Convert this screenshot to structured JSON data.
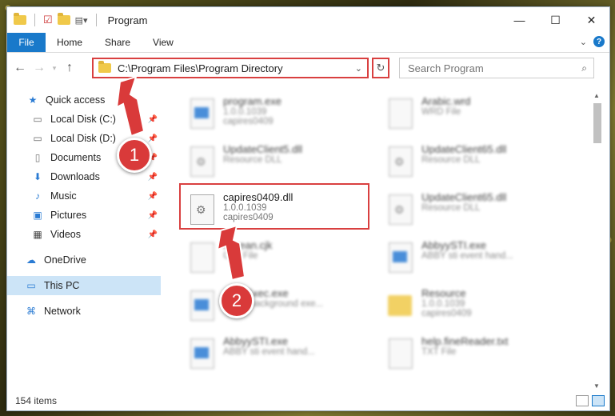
{
  "window": {
    "title": "Program",
    "controls": {
      "minimize": "—",
      "maximize": "☐",
      "close": "✕"
    }
  },
  "ribbon": {
    "file": "File",
    "tabs": [
      "Home",
      "Share",
      "View"
    ]
  },
  "address": {
    "path": "C:\\Program Files\\Program Directory"
  },
  "search": {
    "placeholder": "Search Program"
  },
  "sidebar": {
    "items": [
      {
        "label": "Quick access",
        "icon": "star-icon",
        "pinned": false
      },
      {
        "label": "Local Disk (C:)",
        "icon": "drive-icon",
        "pinned": true
      },
      {
        "label": "Local Disk (D:)",
        "icon": "drive-icon",
        "pinned": true
      },
      {
        "label": "Documents",
        "icon": "documents-icon",
        "pinned": true
      },
      {
        "label": "Downloads",
        "icon": "download-icon",
        "pinned": true
      },
      {
        "label": "Music",
        "icon": "music-icon",
        "pinned": true
      },
      {
        "label": "Pictures",
        "icon": "pictures-icon",
        "pinned": true
      },
      {
        "label": "Videos",
        "icon": "videos-icon",
        "pinned": true
      },
      {
        "label": "OneDrive",
        "icon": "cloud-icon",
        "pinned": false
      },
      {
        "label": "This PC",
        "icon": "pc-icon",
        "pinned": false,
        "selected": true
      },
      {
        "label": "Network",
        "icon": "network-icon",
        "pinned": false
      }
    ]
  },
  "files": [
    {
      "name": "program.exe",
      "line2": "1.0.0.1039",
      "line3": "capires0409",
      "icon": "exe"
    },
    {
      "name": "Arabic.wrd",
      "line2": "WRD File",
      "line3": "",
      "icon": "doc"
    },
    {
      "name": "UpdateClient5.dll",
      "line2": "Resource DLL",
      "line3": "",
      "icon": "gear"
    },
    {
      "name": "UpdateClient65.dll",
      "line2": "Resource DLL",
      "line3": "",
      "icon": "gear"
    },
    {
      "name": "capires0409.dll",
      "line2": "1.0.0.1039",
      "line3": "capires0409",
      "icon": "gear"
    },
    {
      "name": "UpdateClient65.dll",
      "line2": "Resource DLL",
      "line3": "",
      "icon": "gear"
    },
    {
      "name": "Korean.cjk",
      "line2": "CJK File",
      "line3": "",
      "icon": "doc"
    },
    {
      "name": "AbbyySTI.exe",
      "line2": "ABBY sti event hand...",
      "line3": "",
      "icon": "exe"
    },
    {
      "name": "ActivExec.exe",
      "line2": "ABBY background exe...",
      "line3": "",
      "icon": "exe"
    },
    {
      "name": "Resource",
      "line2": "1.0.0.1039",
      "line3": "capires0409",
      "icon": "folder"
    },
    {
      "name": "AbbyySTI.exe",
      "line2": "ABBY sti event hand...",
      "line3": "",
      "icon": "exe"
    },
    {
      "name": "help.fineReader.txt",
      "line2": "TXT File",
      "line3": "",
      "icon": "doc"
    }
  ],
  "status": {
    "count": "154 items"
  },
  "annotations": {
    "step1": "1",
    "step2": "2"
  },
  "colors": {
    "accent": "#1979ca",
    "highlight": "#d94040"
  }
}
